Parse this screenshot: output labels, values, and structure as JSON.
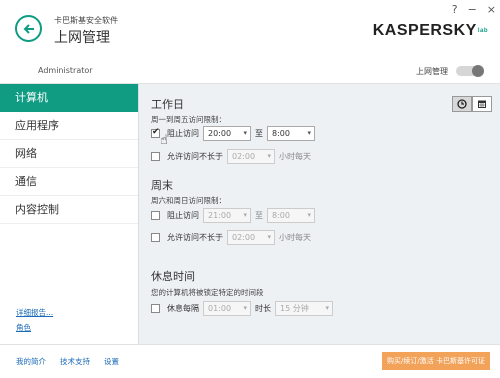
{
  "window": {
    "minimize": "?",
    "close": "×",
    "restore": "−"
  },
  "header": {
    "app_name": "卡巴斯基安全软件",
    "title": "上网管理",
    "logo": "KASPERSKY",
    "logo_lab": "lab"
  },
  "userbar": {
    "username": "Administrator",
    "parental_label": "上网管理",
    "parental_on": true
  },
  "sidebar": {
    "items": [
      {
        "label": "计算机",
        "active": true
      },
      {
        "label": "应用程序"
      },
      {
        "label": "网络"
      },
      {
        "label": "通信"
      },
      {
        "label": "内容控制"
      }
    ],
    "link_details": "详细报告...",
    "link_role": "角色"
  },
  "workday": {
    "title": "工作日",
    "subtitle": "周一到周五访问限制：",
    "block_label": "阻止访问",
    "from": "20:00",
    "to_label": "至",
    "to": "8:00",
    "allow_label": "允许访问不长于",
    "allow_value": "02:00",
    "per_day": "小时每天"
  },
  "weekend": {
    "title": "周末",
    "subtitle": "周六和周日访问限制：",
    "block_label": "阻止访问",
    "from": "21:00",
    "to_label": "至",
    "to": "8:00",
    "allow_label": "允许访问不长于",
    "allow_value": "02:00",
    "per_day": "小时每天"
  },
  "rest": {
    "title": "休息时间",
    "subtitle": "您的计算机将被锁定特定的时间段",
    "every_label": "休息每隔",
    "every_value": "01:00",
    "duration_label": "时长",
    "duration_value": "15 分钟"
  },
  "view_toggle": {
    "clock_icon": "clock-icon",
    "calendar_icon": "calendar-icon"
  },
  "footer": {
    "my_profile": "我的简介",
    "support": "技术支持",
    "settings": "设置",
    "license": "购买/续订/激活 卡巴斯基许可证"
  },
  "colors": {
    "accent": "#0f9c83",
    "link": "#1a6bb8",
    "license": "#f3a25a"
  }
}
